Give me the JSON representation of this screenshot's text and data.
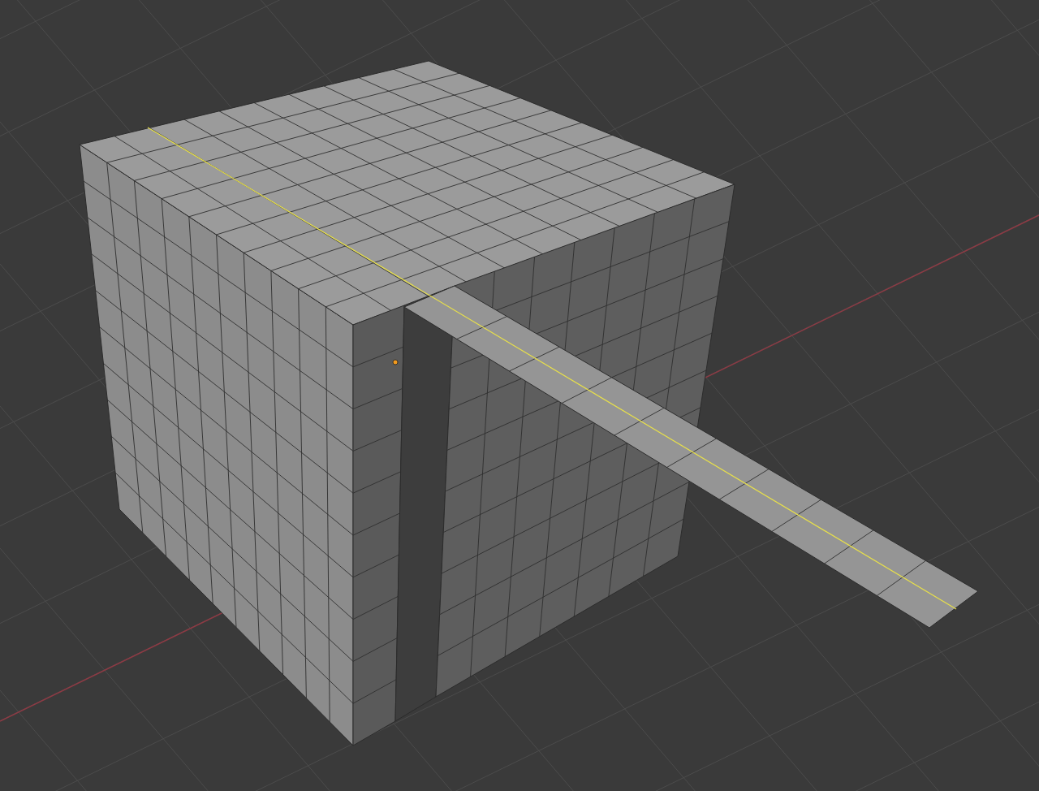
{
  "viewport": {
    "selected_edge": true,
    "origin_shown": true
  }
}
